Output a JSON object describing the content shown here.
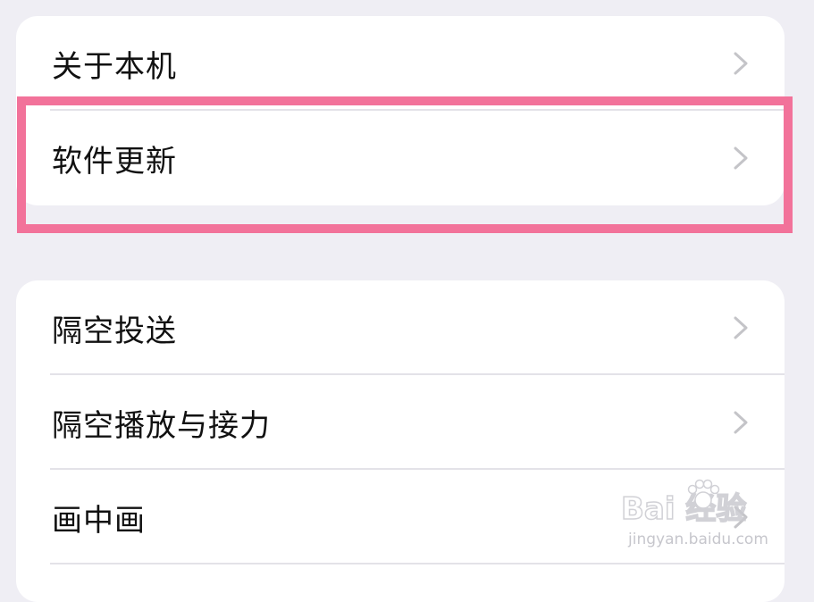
{
  "settings": {
    "group1": [
      {
        "label": "关于本机"
      },
      {
        "label": "软件更新"
      }
    ],
    "group2": [
      {
        "label": "隔空投送"
      },
      {
        "label": "隔空播放与接力"
      },
      {
        "label": "画中画"
      }
    ]
  },
  "annotation": {
    "highlight_color": "#f2729a",
    "highlighted_item": "软件更新"
  },
  "watermark": {
    "logo_text": "Bai  经验",
    "url_text": "jingyan.baidu.com"
  },
  "colors": {
    "background": "#efeef4",
    "card": "#ffffff",
    "text": "#111111",
    "chevron": "#c4c4c8",
    "divider": "#e3e2e8"
  }
}
